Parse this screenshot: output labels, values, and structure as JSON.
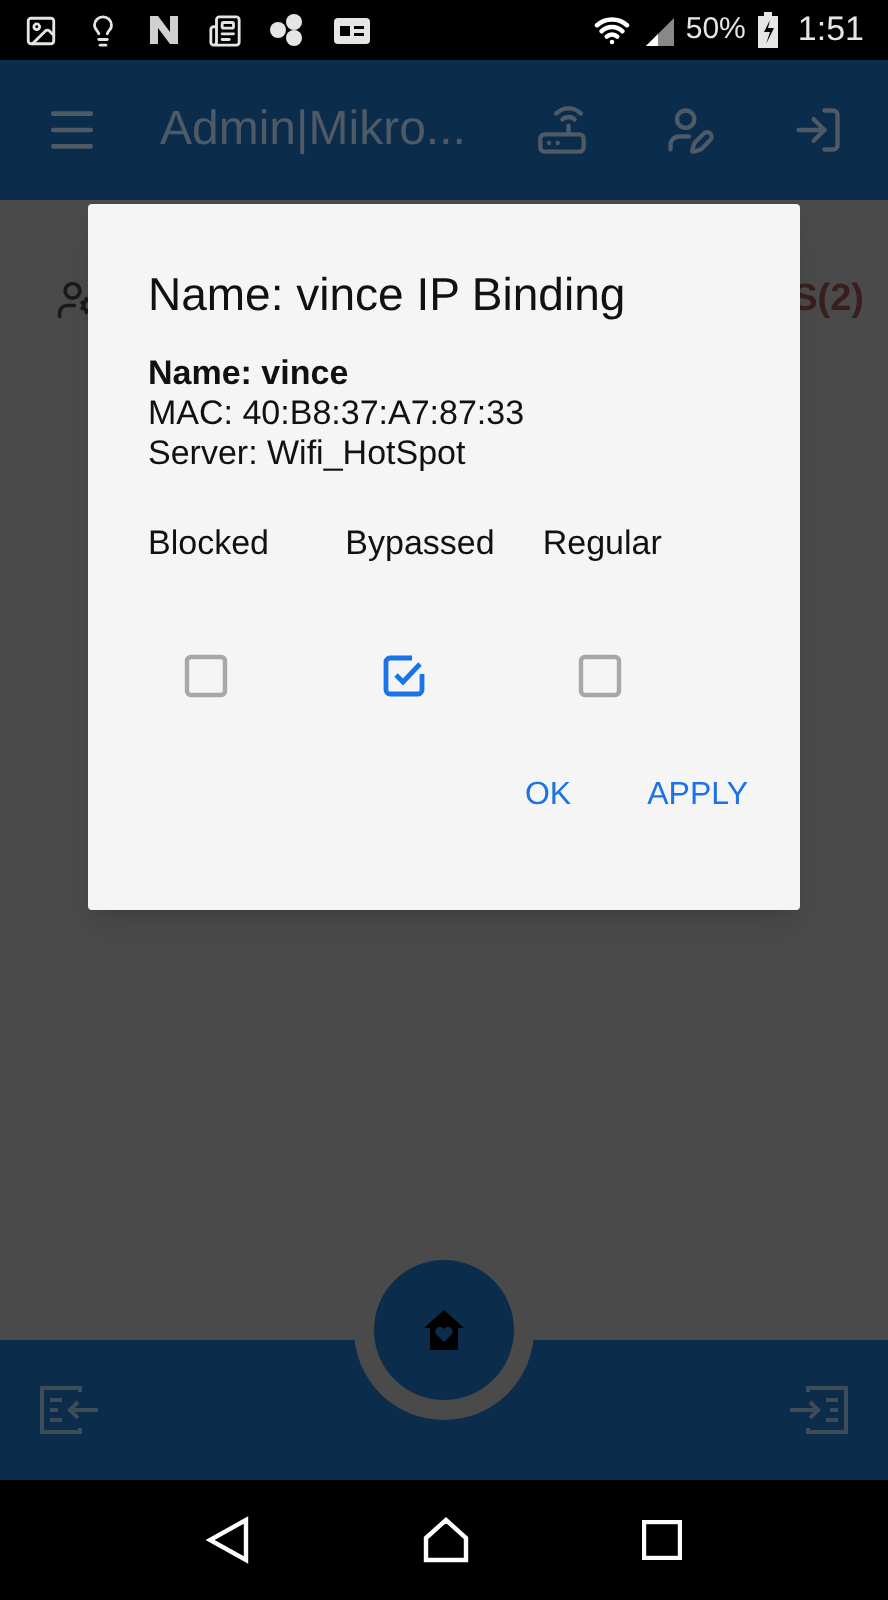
{
  "status_bar": {
    "battery": "50%",
    "time": "1:51"
  },
  "app_bar": {
    "title": "Admin|Mikro..."
  },
  "background": {
    "label": "S(2)"
  },
  "dialog": {
    "title": "Name: vince IP Binding",
    "lines": [
      {
        "text": "Name: vince",
        "kind": "bold"
      },
      {
        "text": "MAC: 40:B8:37:A7:87:33",
        "kind": "plain"
      },
      {
        "text": "Server: Wifi_HotSpot",
        "kind": "plain"
      }
    ],
    "options": [
      {
        "label": "Blocked",
        "checked": false
      },
      {
        "label": "Bypassed",
        "checked": true
      },
      {
        "label": "Regular",
        "checked": false
      }
    ],
    "buttons": [
      "OK",
      "APPLY"
    ]
  }
}
